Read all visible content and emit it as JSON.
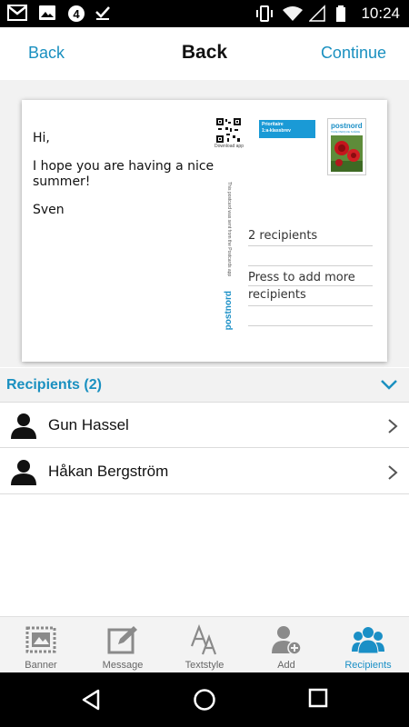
{
  "status_bar": {
    "time": "10:24",
    "notification_icons": [
      "gmail-icon",
      "image-icon",
      "circle-4-icon",
      "check-icon"
    ],
    "system_icons": [
      "vibrate-icon",
      "wifi-icon",
      "signal-icon",
      "battery-icon"
    ]
  },
  "header": {
    "back_label": "Back",
    "title": "Back",
    "continue_label": "Continue"
  },
  "postcard": {
    "message_lines": [
      "Hi,",
      "I hope you are having a nice summer!",
      "Sven"
    ],
    "qr_label": "Download app",
    "side_text": "This postcard was sent from the Postcards app",
    "brand_vertical": "postnord",
    "priority_label_1": "Prioritaire",
    "priority_label_2": "1:a-klassbrev",
    "stamp_brand": "postnord",
    "stamp_subtitle": "TAXE PERÇUE SUÈDE",
    "recipients_text": "2 recipients",
    "add_more_text": "Press to add more recipients"
  },
  "recipients": {
    "title": "Recipients (2)",
    "items": [
      {
        "name": "Gun Hassel"
      },
      {
        "name": "Håkan Bergström"
      }
    ]
  },
  "bottom_nav": {
    "items": [
      {
        "label": "Banner",
        "icon": "banner-icon",
        "active": false
      },
      {
        "label": "Message",
        "icon": "message-edit-icon",
        "active": false
      },
      {
        "label": "Textstyle",
        "icon": "textstyle-icon",
        "active": false
      },
      {
        "label": "Add",
        "icon": "add-person-icon",
        "active": false
      },
      {
        "label": "Recipients",
        "icon": "recipients-icon",
        "active": true
      }
    ]
  },
  "colors": {
    "accent": "#1a90c0",
    "inactive_icon": "#8a8a8a",
    "background": "#f2f2f2"
  }
}
